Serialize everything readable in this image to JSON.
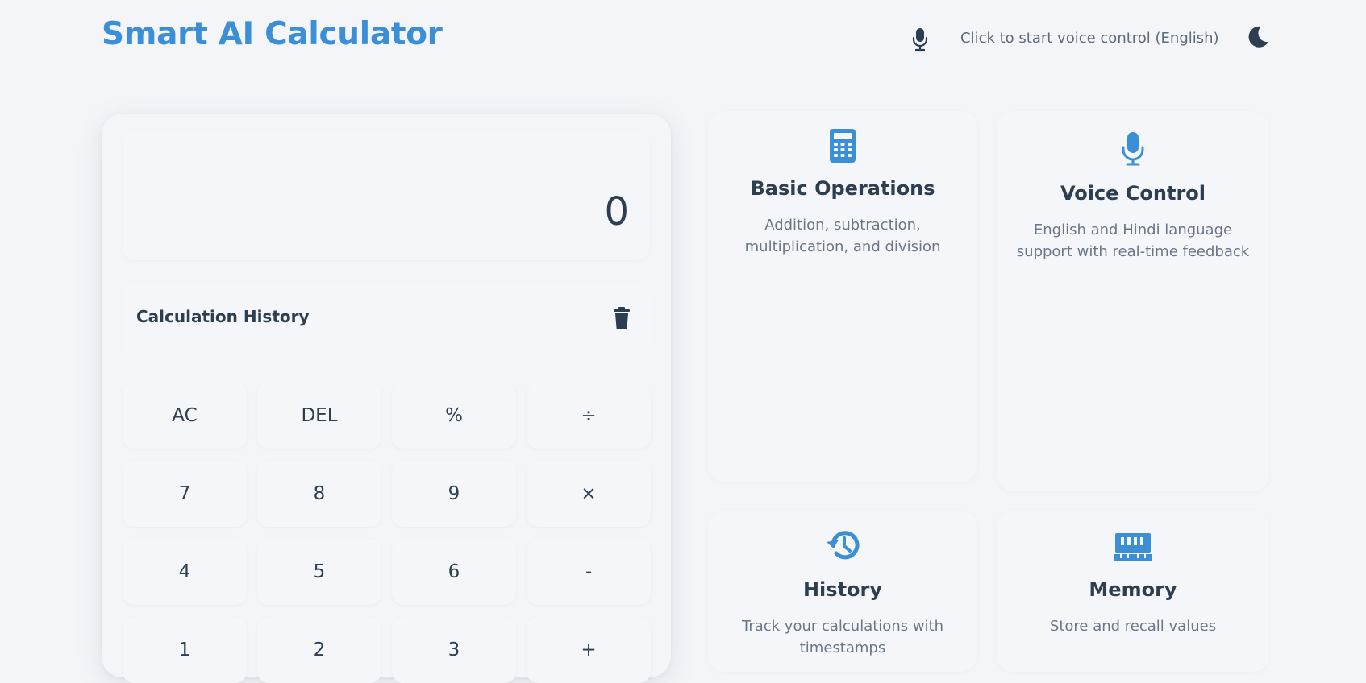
{
  "header": {
    "title": "Smart AI Calculator",
    "voice_icon": "microphone-icon",
    "voice_status": "Click to start voice control (English)",
    "theme_icon": "moon-icon"
  },
  "calculator": {
    "display_value": "0",
    "history_title": "Calculation History",
    "history_clear_icon": "trash-icon",
    "keys": [
      [
        "AC",
        "DEL",
        "%",
        "÷"
      ],
      [
        "7",
        "8",
        "9",
        "×"
      ],
      [
        "4",
        "5",
        "6",
        "-"
      ],
      [
        "1",
        "2",
        "3",
        "+"
      ]
    ]
  },
  "features": [
    {
      "icon": "calculator-icon",
      "title": "Basic Operations",
      "description": "Addition, subtraction, multiplication, and division"
    },
    {
      "icon": "microphone-icon",
      "title": "Voice Control",
      "description": "English and Hindi language support with real-time feedback"
    },
    {
      "icon": "history-icon",
      "title": "History",
      "description": "Track your calculations with timestamps"
    },
    {
      "icon": "memory-icon",
      "title": "Memory",
      "description": "Store and recall values"
    }
  ],
  "colors": {
    "accent": "#3a8fd6",
    "text": "#2c3e50",
    "background": "#f3f5f9"
  }
}
